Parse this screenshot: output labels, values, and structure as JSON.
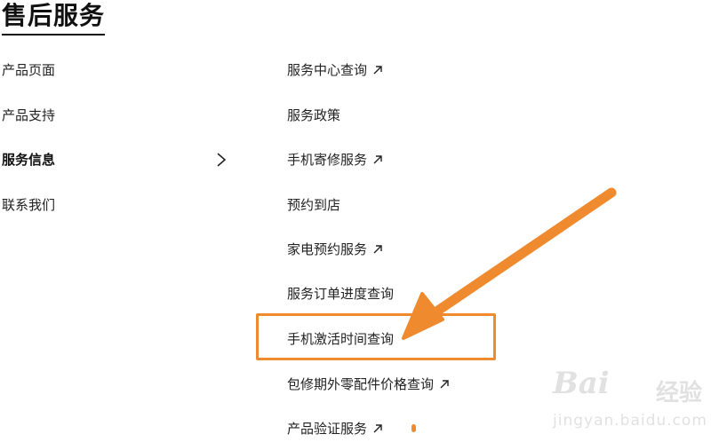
{
  "page": {
    "title": "售后服务"
  },
  "left_menu": {
    "items": [
      {
        "label": "产品页面",
        "active": false
      },
      {
        "label": "产品支持",
        "active": false
      },
      {
        "label": "服务信息",
        "active": true
      },
      {
        "label": "联系我们",
        "active": false
      }
    ]
  },
  "right_menu": {
    "items": [
      {
        "label": "服务中心查询",
        "external": true
      },
      {
        "label": "服务政策",
        "external": false
      },
      {
        "label": "手机寄修服务",
        "external": true
      },
      {
        "label": "预约到店",
        "external": false
      },
      {
        "label": "家电预约服务",
        "external": true
      },
      {
        "label": "服务订单进度查询",
        "external": false
      },
      {
        "label": "手机激活时间查询",
        "external": false,
        "highlighted": true
      },
      {
        "label": "包修期外零配件价格查询",
        "external": true
      },
      {
        "label": "产品验证服务",
        "external": true
      }
    ]
  },
  "annotation": {
    "color": "#f08a2e"
  },
  "watermark": {
    "brand": "Bai",
    "cn": "经验",
    "url": "jingyan.baidu.com"
  }
}
